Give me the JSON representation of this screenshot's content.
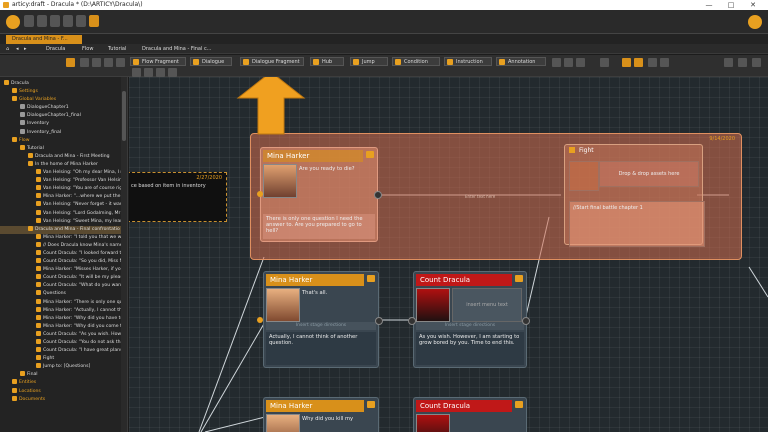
{
  "window": {
    "title": "articy:draft - Dracula * (D:\\ARTICY\\Dracula\\)",
    "controls": [
      "—",
      "□",
      "✕"
    ]
  },
  "tab": {
    "label": "Dracula and Mina - F..."
  },
  "breadcrumb": [
    "Dracula",
    "Flow",
    "Tutorial",
    "Dracula and Mina - Final c..."
  ],
  "toolbar": {
    "node_buttons": [
      "Flow Fragment",
      "Dialogue",
      "Dialogue Fragment",
      "Hub",
      "Jump",
      "Condition",
      "Instruction",
      "Annotation"
    ]
  },
  "tree": [
    {
      "label": "Dracula",
      "indent": 0,
      "style": "normal",
      "icon": "#e8a020"
    },
    {
      "label": "Settings",
      "indent": 1,
      "style": "orange",
      "icon": "#e8a020"
    },
    {
      "label": "Global Variables",
      "indent": 1,
      "style": "orange",
      "icon": "#e8a020"
    },
    {
      "label": "DialogueChapter1",
      "indent": 2,
      "style": "normal",
      "icon": "#999"
    },
    {
      "label": "DialogueChapter1_final",
      "indent": 2,
      "style": "normal",
      "icon": "#999"
    },
    {
      "label": "Inventory",
      "indent": 2,
      "style": "normal",
      "icon": "#999"
    },
    {
      "label": "Inventory_final",
      "indent": 2,
      "style": "normal",
      "icon": "#999"
    },
    {
      "label": "Flow",
      "indent": 1,
      "style": "orange",
      "icon": "#e8a020"
    },
    {
      "label": "Tutorial",
      "indent": 2,
      "style": "normal",
      "icon": "#e8a020"
    },
    {
      "label": "Dracula and Mina - First Meeting",
      "indent": 3,
      "style": "normal",
      "icon": "#e8a020"
    },
    {
      "label": "In the home of Mina Harker",
      "indent": 3,
      "style": "normal",
      "icon": "#e8a020"
    },
    {
      "label": "Van Helsing: \"Oh my dear Mina, I n",
      "indent": 4,
      "style": "normal",
      "icon": "#e8a020"
    },
    {
      "label": "Van Helsing: \"Professor Van Helsin",
      "indent": 4,
      "style": "normal",
      "icon": "#e8a020"
    },
    {
      "label": "Van Helsing: \"You are of course righ",
      "indent": 4,
      "style": "normal",
      "icon": "#e8a020"
    },
    {
      "label": "Mina Harker: \"...where we put the g",
      "indent": 4,
      "style": "normal",
      "icon": "#e8a020"
    },
    {
      "label": "Van Helsing: \"Never forget - it was",
      "indent": 4,
      "style": "normal",
      "icon": "#e8a020"
    },
    {
      "label": "Van Helsing: \"Lord Godalming, Mr",
      "indent": 4,
      "style": "normal",
      "icon": "#e8a020"
    },
    {
      "label": "Van Helsing: \"Sweet Mina, my lear",
      "indent": 4,
      "style": "normal",
      "icon": "#e8a020"
    },
    {
      "label": "Dracula and Mina - Final confrontatio",
      "indent": 3,
      "style": "sel",
      "icon": "#e8a020"
    },
    {
      "label": "Mina Harker: \"I told you that we wi",
      "indent": 4,
      "style": "normal",
      "icon": "#e8a020"
    },
    {
      "label": "// Does Dracula know Mina's name",
      "indent": 4,
      "style": "normal",
      "icon": "#e8a020"
    },
    {
      "label": "Count Dracula: \"I looked forward to",
      "indent": 4,
      "style": "normal",
      "icon": "#e8a020"
    },
    {
      "label": "Count Dracula: \"So you did, Miss N",
      "indent": 4,
      "style": "normal",
      "icon": "#e8a020"
    },
    {
      "label": "Mina Harker: \"Misses Harker, if you",
      "indent": 4,
      "style": "normal",
      "icon": "#e8a020"
    },
    {
      "label": "Count Dracula: \"It will be my pleasu",
      "indent": 4,
      "style": "normal",
      "icon": "#e8a020"
    },
    {
      "label": "Count Dracula: \"What do you want",
      "indent": 4,
      "style": "normal",
      "icon": "#e8a020"
    },
    {
      "label": "Questions",
      "indent": 4,
      "style": "normal",
      "icon": "#e8a020"
    },
    {
      "label": "Mina Harker: \"There is only one qu",
      "indent": 4,
      "style": "normal",
      "icon": "#e8a020"
    },
    {
      "label": "Mina Harker: \"Actually, I cannot thi",
      "indent": 4,
      "style": "normal",
      "icon": "#e8a020"
    },
    {
      "label": "Mina Harker: \"Why did you have to",
      "indent": 4,
      "style": "normal",
      "icon": "#e8a020"
    },
    {
      "label": "Mina Harker: \"Why did you come t",
      "indent": 4,
      "style": "normal",
      "icon": "#e8a020"
    },
    {
      "label": "Count Dracula: \"As you wish. How",
      "indent": 4,
      "style": "normal",
      "icon": "#e8a020"
    },
    {
      "label": "Count Dracula: \"You do not ask tha",
      "indent": 4,
      "style": "normal",
      "icon": "#e8a020"
    },
    {
      "label": "Count Dracula: \"I have great plans",
      "indent": 4,
      "style": "normal",
      "icon": "#e8a020"
    },
    {
      "label": "Fight",
      "indent": 4,
      "style": "normal",
      "icon": "#e8a020"
    },
    {
      "label": "Jump to: [Questions]",
      "indent": 4,
      "style": "normal",
      "icon": "#e8a020"
    },
    {
      "label": "Final",
      "indent": 2,
      "style": "normal",
      "icon": "#e8a020"
    },
    {
      "label": "Entities",
      "indent": 1,
      "style": "orange",
      "icon": "#e8a020"
    },
    {
      "label": "Locations",
      "indent": 1,
      "style": "orange",
      "icon": "#e8a020"
    },
    {
      "label": "Documents",
      "indent": 1,
      "style": "orange",
      "icon": "#e8a020"
    }
  ],
  "canvas": {
    "zone_date": "9/14/2020",
    "note": {
      "date": "2/27/2020",
      "text": "ce based on item in inventory"
    },
    "fight": {
      "title": "Fight",
      "placeholder": "Drop & drop assets here",
      "script": "//Start final battle chapter 1",
      "mini_label": "Enter text here"
    },
    "cards": {
      "top_mina": {
        "speaker": "Mina Harker",
        "text": "Are you ready to die?",
        "body": "There is only one question I need the answer to. Are you prepared to go to hell?"
      },
      "mid_mina": {
        "speaker": "Mina Harker",
        "text": "That's all.",
        "direction": "Insert stage directions",
        "body": "Actually, I cannot think of another question."
      },
      "mid_dracula": {
        "speaker": "Count Dracula",
        "menu": "insert menu text",
        "direction": "Insert stage directions",
        "body": "As you wish. However, I am starting to grow bored by you. Time to end this."
      },
      "bot_mina": {
        "speaker": "Mina Harker",
        "text": "Why did you kill my"
      },
      "bot_dracula": {
        "speaker": "Count Dracula"
      }
    }
  },
  "colors": {
    "accent": "#e8a020",
    "mina_header": "#d8901a",
    "dracula_header": "#c01818",
    "zone": "#d66e50"
  }
}
